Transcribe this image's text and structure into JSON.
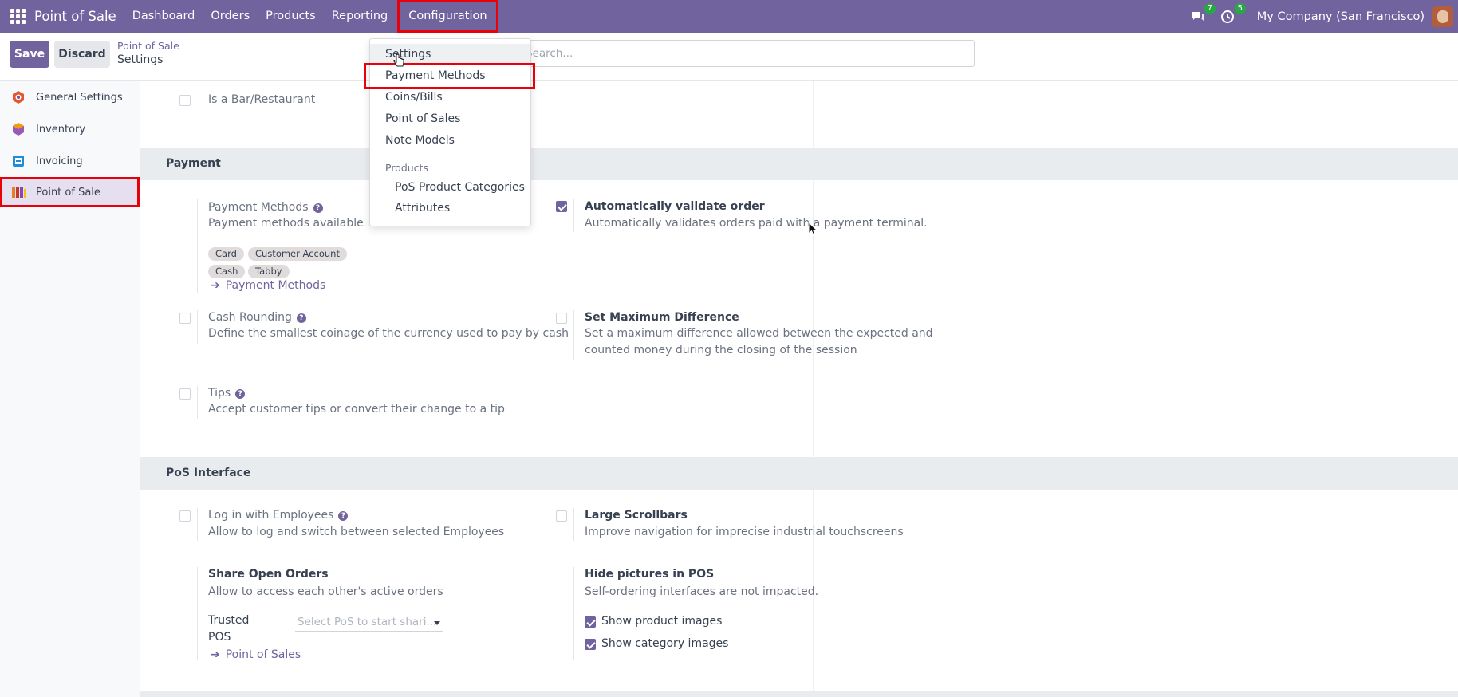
{
  "topbar": {
    "brand": "Point of Sale",
    "menu": [
      "Dashboard",
      "Orders",
      "Products",
      "Reporting",
      "Configuration"
    ],
    "messages_badge": "7",
    "activities_badge": "5",
    "company": "My Company (San Francisco)"
  },
  "controls": {
    "save": "Save",
    "discard": "Discard",
    "breadcrumb_parent": "Point of Sale",
    "breadcrumb_current": "Settings",
    "search_placeholder": "Search..."
  },
  "sidebar": {
    "items": [
      {
        "label": "General Settings",
        "color": "#e4572e"
      },
      {
        "label": "Inventory",
        "color": "#9b59b6"
      },
      {
        "label": "Invoicing",
        "color": "#1f8dd6"
      },
      {
        "label": "Point of Sale",
        "color": "#c0392b"
      }
    ]
  },
  "top_setting": {
    "label": "Is a Bar/Restaurant"
  },
  "payment": {
    "title": "Payment",
    "payment_methods": {
      "label": "Payment Methods",
      "desc": "Payment methods available",
      "tags": [
        "Card",
        "Customer Account",
        "Cash",
        "Tabby"
      ],
      "link": "Payment Methods"
    },
    "auto_validate": {
      "label": "Automatically validate order",
      "desc": "Automatically validates orders paid with a payment terminal."
    },
    "cash_rounding": {
      "label": "Cash Rounding",
      "desc": "Define the smallest coinage of the currency used to pay by cash"
    },
    "max_difference": {
      "label": "Set Maximum Difference",
      "desc_line1": "Set a maximum difference allowed between the expected and",
      "desc_line2": "counted money during the closing of the session"
    },
    "tips": {
      "label": "Tips",
      "desc": "Accept customer tips or convert their change to a tip"
    }
  },
  "pos_interface": {
    "title": "PoS Interface",
    "login_employees": {
      "label": "Log in with Employees",
      "desc": "Allow to log and switch between selected Employees"
    },
    "large_scrollbars": {
      "label": "Large Scrollbars",
      "desc": "Improve navigation for imprecise industrial touchscreens"
    },
    "share_orders": {
      "label": "Share Open Orders",
      "desc": "Allow to access each other's active orders",
      "trusted_label_1": "Trusted",
      "trusted_label_2": "POS",
      "select_placeholder": "Select PoS to start shari...",
      "link": "Point of Sales"
    },
    "hide_pictures": {
      "label": "Hide pictures in POS",
      "desc": "Self-ordering interfaces are not impacted.",
      "show_product_images": "Show product images",
      "show_category_images": "Show category images"
    }
  },
  "dropdown": {
    "items": [
      "Settings",
      "Payment Methods",
      "Coins/Bills",
      "Point of Sales",
      "Note Models"
    ],
    "section_header": "Products",
    "sub_items": [
      "PoS Product Categories",
      "Attributes"
    ]
  }
}
